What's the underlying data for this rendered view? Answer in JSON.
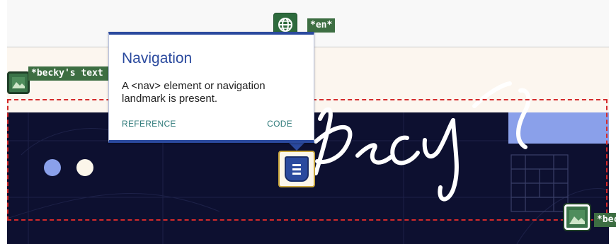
{
  "language_indicator": {
    "icon": "globe-icon",
    "label": "*en*"
  },
  "image_alt_tags": {
    "left": {
      "icon": "image-icon",
      "label": "*becky's text lo"
    },
    "right": {
      "icon": "image-icon",
      "label": "*beck"
    }
  },
  "popup": {
    "title": "Navigation",
    "description": "A <nav> element or navigation landmark is present.",
    "reference_label": "REFERENCE",
    "code_label": "CODE"
  },
  "nav_marker": {
    "icon": "navigation-landmark-icon"
  },
  "colors": {
    "hero_background": "#0d1030",
    "accent_blue": "#2b4a9e",
    "tag_green": "#3d6e42",
    "outline_red": "#d42a2a"
  }
}
